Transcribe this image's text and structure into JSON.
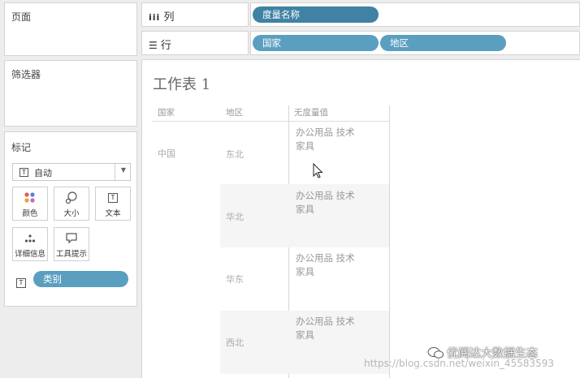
{
  "cards": {
    "pages": {
      "title": "页面"
    },
    "filters": {
      "title": "筛选器"
    },
    "marks": {
      "title": "标记",
      "mark_type": "自动",
      "buttons": {
        "color": "颜色",
        "size": "大小",
        "text": "文本",
        "detail": "详细信息",
        "tooltip": "工具提示"
      },
      "field_pill": "类别"
    }
  },
  "shelves": {
    "columns": {
      "label": "列",
      "pills": [
        "度量名称"
      ]
    },
    "rows": {
      "label": "行",
      "pills": [
        "国家",
        "地区"
      ]
    }
  },
  "view": {
    "sheet_title": "工作表 1",
    "headers": [
      "国家",
      "地区",
      "无度量值"
    ],
    "country": "中国",
    "regions": [
      {
        "name": "东北",
        "line1": "办公用品   技术",
        "line2": "家具"
      },
      {
        "name": "华北",
        "line1": "办公用品   技术",
        "line2": "家具"
      },
      {
        "name": "华东",
        "line1": "办公用品   技术",
        "line2": "家具"
      },
      {
        "name": "西北",
        "line1": "办公用品   技术",
        "line2": "家具"
      }
    ]
  },
  "overlay": {
    "watermark": "https://blog.csdn.net/weixin_45583593",
    "brand": "优阅达大数据生态"
  },
  "colors": {
    "pill_dark": "#3f82a4",
    "pill_mid": "#5a9fbf",
    "band": "#f5f5f5"
  }
}
